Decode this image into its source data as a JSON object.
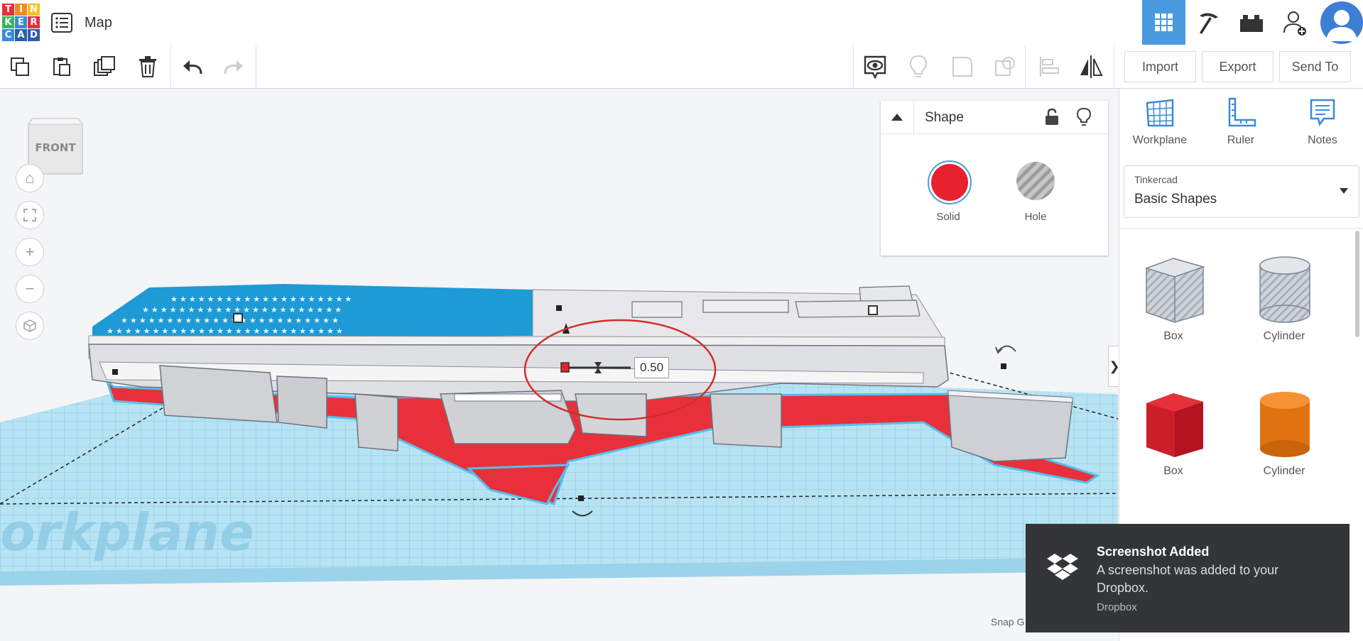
{
  "header": {
    "logo_letters": [
      "T",
      "I",
      "N",
      "K",
      "E",
      "R",
      "C",
      "A",
      "D"
    ],
    "logo_colors": [
      "#e5303a",
      "#f38a23",
      "#f6c026",
      "#3eb45a",
      "#3a8bd8",
      "#e5303a",
      "#3a8bd8",
      "#2e5ea8",
      "#2e5ea8"
    ],
    "title": "Map",
    "buttons": [
      "grid-view-icon",
      "pickaxe-icon",
      "bricks-icon",
      "add-user-icon",
      "avatar"
    ]
  },
  "toolbar": {
    "left_icons": [
      "copy-icon",
      "paste-icon",
      "duplicate-icon",
      "trash-icon",
      "undo-icon",
      "redo-icon"
    ],
    "right_icons": [
      "visibility-icon",
      "lightbulb-icon",
      "group-icon",
      "ungroup-icon",
      "align-icon",
      "mirror-icon"
    ],
    "import_label": "Import",
    "export_label": "Export",
    "sendto_label": "Send To"
  },
  "viewport": {
    "viewcube_label": "FRONT",
    "nav_buttons": [
      "home-icon",
      "fit-icon",
      "zoom-in-icon",
      "zoom-out-icon",
      "ortho-icon"
    ],
    "dimension_value": "0.50",
    "workplane_watermark": "orkplane",
    "snap_label": "Snap G"
  },
  "shape_panel": {
    "title": "Shape",
    "solid_label": "Solid",
    "hole_label": "Hole",
    "solid_color": "#e8212f"
  },
  "right_panel": {
    "tools": [
      {
        "label": "Workplane",
        "icon": "workplane-icon"
      },
      {
        "label": "Ruler",
        "icon": "ruler-icon"
      },
      {
        "label": "Notes",
        "icon": "notes-icon"
      }
    ],
    "dropdown": {
      "category": "Tinkercad",
      "value": "Basic Shapes"
    },
    "shapes": [
      {
        "label": "Box",
        "kind": "hole-box"
      },
      {
        "label": "Cylinder",
        "kind": "hole-cylinder"
      },
      {
        "label": "Box",
        "kind": "red-box"
      },
      {
        "label": "Cylinder",
        "kind": "orange-cylinder"
      }
    ]
  },
  "toast": {
    "title": "Screenshot Added",
    "message": "A screenshot was added to your Dropbox.",
    "source": "Dropbox"
  },
  "colors": {
    "accent": "#4a9ae0",
    "flag_blue": "#1e9ad6",
    "red": "#e8303a",
    "workplane": "#a7dcf0"
  }
}
